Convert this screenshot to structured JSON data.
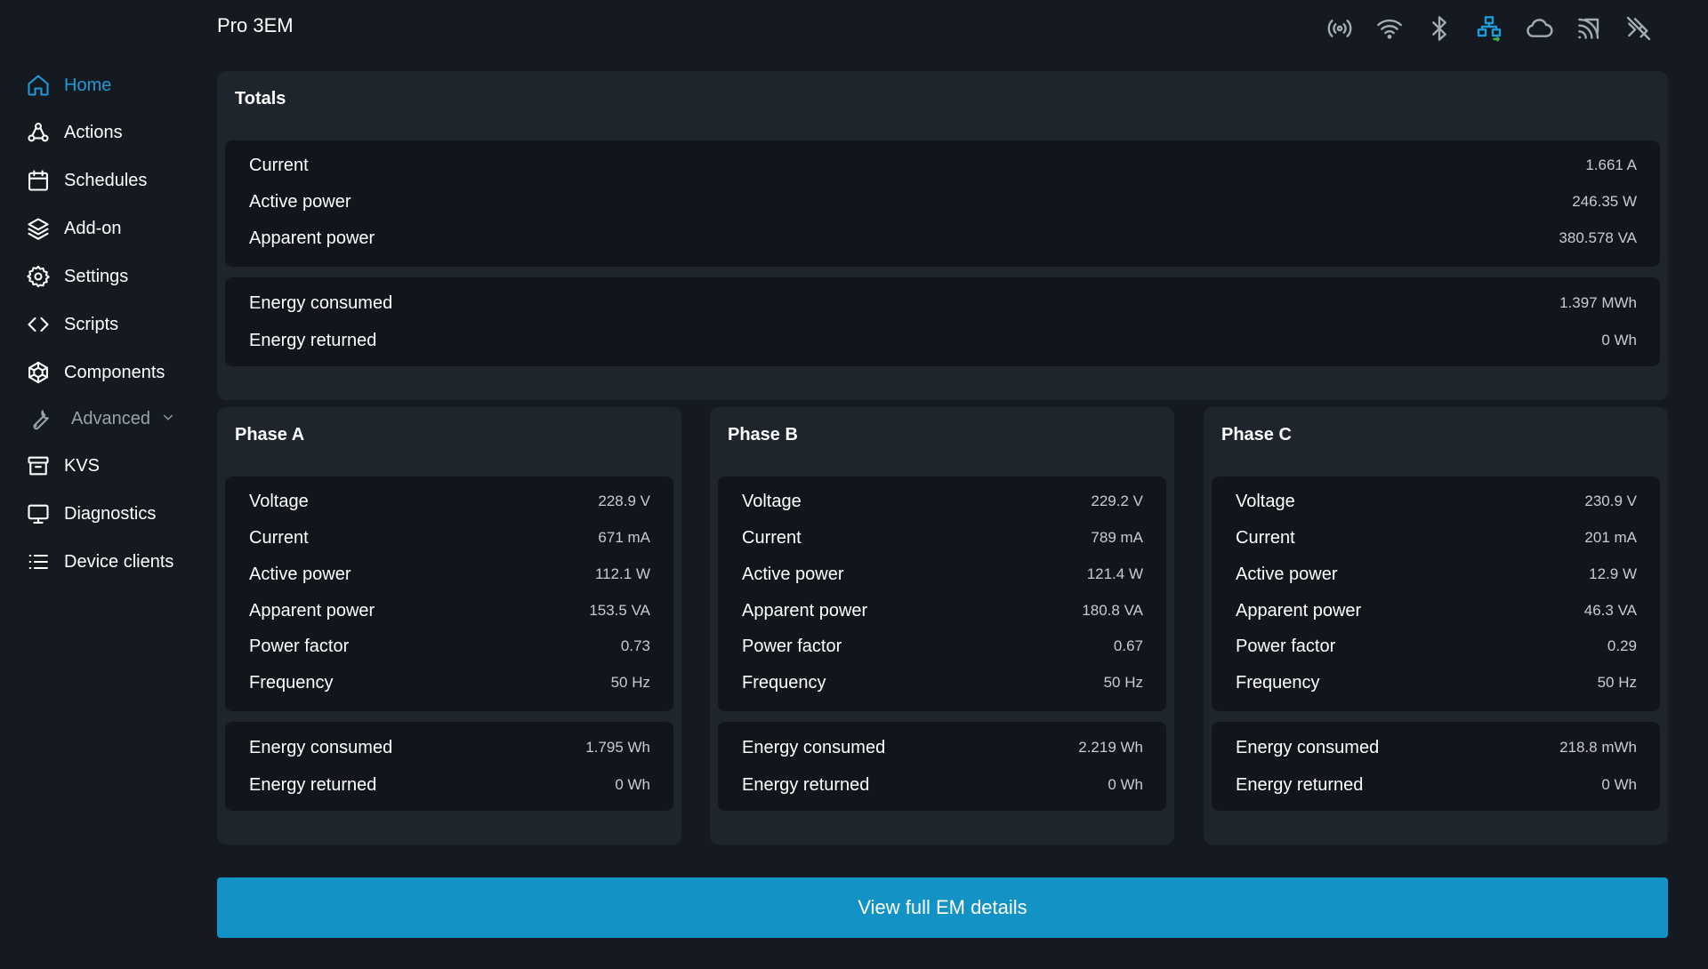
{
  "header": {
    "device_name": "Pro 3EM",
    "status_icons": [
      {
        "name": "broadcast-icon",
        "active": false
      },
      {
        "name": "wifi-icon",
        "active": false
      },
      {
        "name": "bluetooth-icon",
        "active": false
      },
      {
        "name": "ethernet-icon",
        "active": true
      },
      {
        "name": "cloud-icon",
        "active": false
      },
      {
        "name": "mqtt-icon",
        "active": false
      },
      {
        "name": "websocket-off-icon",
        "active": false
      }
    ]
  },
  "sidebar": {
    "items": [
      {
        "label": "Home",
        "icon": "home-icon"
      },
      {
        "label": "Actions",
        "icon": "webhook-icon"
      },
      {
        "label": "Schedules",
        "icon": "calendar-icon"
      },
      {
        "label": "Add-on",
        "icon": "layers-icon"
      },
      {
        "label": "Settings",
        "icon": "gear-icon"
      },
      {
        "label": "Scripts",
        "icon": "code-icon"
      },
      {
        "label": "Components",
        "icon": "components-icon"
      },
      {
        "label": "Advanced",
        "icon": "wrench-icon"
      },
      {
        "label": "KVS",
        "icon": "archive-icon"
      },
      {
        "label": "Diagnostics",
        "icon": "monitor-icon"
      },
      {
        "label": "Device clients",
        "icon": "list-icon"
      }
    ],
    "active_item": "Home"
  },
  "totals": {
    "title": "Totals",
    "measurements": [
      {
        "label": "Current",
        "value": "1.661 A"
      },
      {
        "label": "Active power",
        "value": "246.35 W"
      },
      {
        "label": "Apparent power",
        "value": "380.578 VA"
      }
    ],
    "energy": [
      {
        "label": "Energy consumed",
        "value": "1.397 MWh"
      },
      {
        "label": "Energy returned",
        "value": "0 Wh"
      }
    ]
  },
  "phases": [
    {
      "title": "Phase A",
      "measurements": [
        {
          "label": "Voltage",
          "value": "228.9 V"
        },
        {
          "label": "Current",
          "value": "671 mA"
        },
        {
          "label": "Active power",
          "value": "112.1 W"
        },
        {
          "label": "Apparent power",
          "value": "153.5 VA"
        },
        {
          "label": "Power factor",
          "value": "0.73"
        },
        {
          "label": "Frequency",
          "value": "50 Hz"
        }
      ],
      "energy": [
        {
          "label": "Energy consumed",
          "value": "1.795 Wh"
        },
        {
          "label": "Energy returned",
          "value": "0 Wh"
        }
      ]
    },
    {
      "title": "Phase B",
      "measurements": [
        {
          "label": "Voltage",
          "value": "229.2 V"
        },
        {
          "label": "Current",
          "value": "789 mA"
        },
        {
          "label": "Active power",
          "value": "121.4 W"
        },
        {
          "label": "Apparent power",
          "value": "180.8 VA"
        },
        {
          "label": "Power factor",
          "value": "0.67"
        },
        {
          "label": "Frequency",
          "value": "50 Hz"
        }
      ],
      "energy": [
        {
          "label": "Energy consumed",
          "value": "2.219 Wh"
        },
        {
          "label": "Energy returned",
          "value": "0 Wh"
        }
      ]
    },
    {
      "title": "Phase C",
      "measurements": [
        {
          "label": "Voltage",
          "value": "230.9 V"
        },
        {
          "label": "Current",
          "value": "201 mA"
        },
        {
          "label": "Active power",
          "value": "12.9 W"
        },
        {
          "label": "Apparent power",
          "value": "46.3 VA"
        },
        {
          "label": "Power factor",
          "value": "0.29"
        },
        {
          "label": "Frequency",
          "value": "50 Hz"
        }
      ],
      "energy": [
        {
          "label": "Energy consumed",
          "value": "218.8 mWh"
        },
        {
          "label": "Energy returned",
          "value": "0 Wh"
        }
      ]
    }
  ],
  "actions": {
    "details_button": "View full EM details"
  },
  "colors": {
    "accent": "#1e9ad6",
    "background": "#151a21",
    "card": "#1f252d",
    "inner": "#12161c",
    "button": "#1392c6"
  }
}
